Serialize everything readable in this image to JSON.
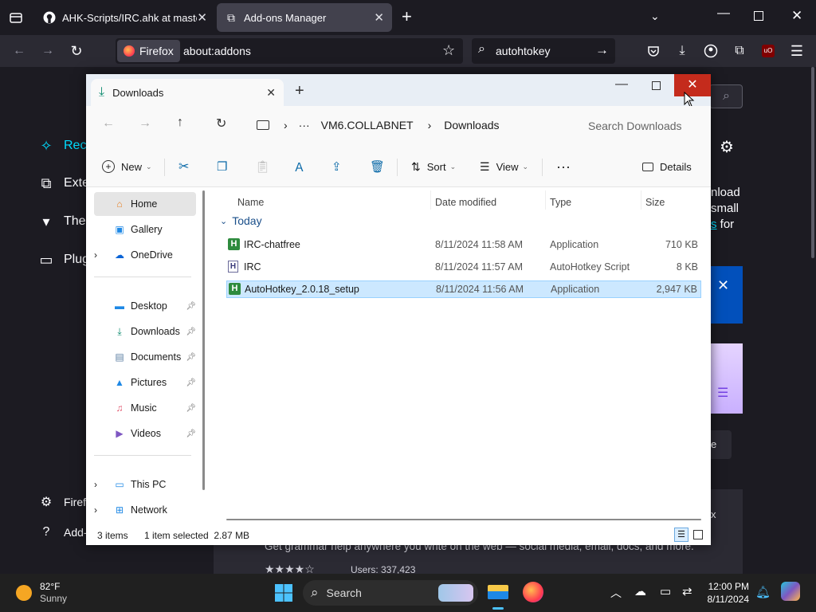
{
  "firefox": {
    "tabs": [
      {
        "title": "AHK-Scripts/IRC.ahk at master"
      },
      {
        "title": "Add-ons Manager"
      }
    ],
    "identity_label": "Firefox",
    "url": "about:addons",
    "search_value": "autohtokey"
  },
  "addons": {
    "categories": [
      "Reco",
      "Exte",
      "Ther",
      "Plug"
    ],
    "bottom_links": [
      "Firefo",
      "Add-"
    ],
    "partial_text": [
      "nload",
      "small",
      "s",
      "for"
    ],
    "partial_button": "e",
    "partial_x_button": "x",
    "footer_text": "Get grammar help anywhere you write on the web — social media, email, docs, and more.",
    "users_text": "Users: 337,423"
  },
  "explorer": {
    "tab_title": "Downloads",
    "breadcrumb": [
      "VM6.COLLABNET",
      "Downloads"
    ],
    "search_placeholder": "Search Downloads",
    "commands": {
      "new": "New",
      "sort": "Sort",
      "view": "View",
      "details": "Details"
    },
    "nav": {
      "home": "Home",
      "gallery": "Gallery",
      "onedrive": "OneDrive",
      "desktop": "Desktop",
      "downloads": "Downloads",
      "documents": "Documents",
      "pictures": "Pictures",
      "music": "Music",
      "videos": "Videos",
      "thispc": "This PC",
      "network": "Network"
    },
    "columns": [
      "Name",
      "Date modified",
      "Type",
      "Size"
    ],
    "group": "Today",
    "files": [
      {
        "name": "IRC-chatfree",
        "date": "8/11/2024 11:58 AM",
        "type": "Application",
        "size": "710 KB",
        "icon": "ahk-exe-icon"
      },
      {
        "name": "IRC",
        "date": "8/11/2024 11:57 AM",
        "type": "AutoHotkey Script",
        "size": "8 KB",
        "icon": "ahk-script-icon"
      },
      {
        "name": "AutoHotkey_2.0.18_setup",
        "date": "8/11/2024 11:56 AM",
        "type": "Application",
        "size": "2,947 KB",
        "icon": "ahk-exe-icon",
        "selected": true
      }
    ],
    "status": {
      "count": "3 items",
      "selection": "1 item selected  2.87 MB"
    }
  },
  "taskbar": {
    "weather_temp": "82°F",
    "weather_desc": "Sunny",
    "search_placeholder": "Search",
    "time": "12:00 PM",
    "date": "8/11/2024"
  },
  "colors": {
    "ff_dark": "#1c1b22",
    "ff_nav": "#2b2a33",
    "ff_accent": "#0060df",
    "selection": "#cce8ff",
    "close_red": "#c42b1c",
    "ahk_green": "#2e8b3e"
  }
}
